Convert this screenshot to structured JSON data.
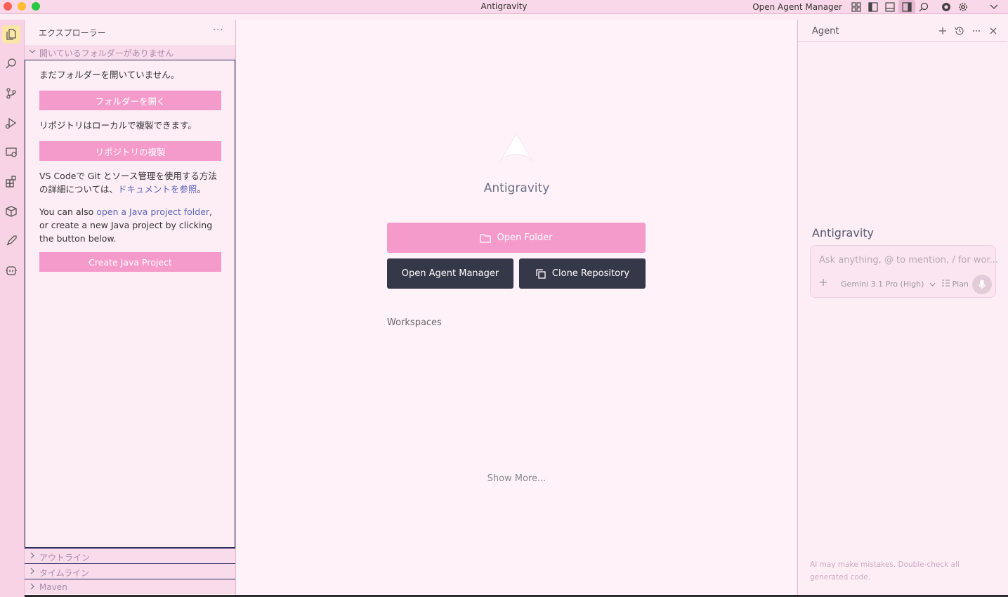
{
  "window": {
    "title": "Antigravity",
    "open_agent_manager": "Open Agent Manager"
  },
  "sidebar": {
    "header": "エクスプローラー",
    "more": "···",
    "section_title": "開いているフォルダーがありません",
    "no_folder_text": "まだフォルダーを開いていません。",
    "open_folder_button": "フォルダーを開く",
    "clone_text": "リポジトリはローカルで複製できます。",
    "clone_button": "リポジトリの複製",
    "git_text_1": "VS Codeで Git とソース管理を使用する方法",
    "git_text_2": "の詳細については、",
    "git_link": "ドキュメントを参照",
    "git_text_3": "。",
    "java_text_1": "You can also ",
    "java_link": "open a Java project folder",
    "java_text_2": ", or create a new Java project by clicking the button below.",
    "create_java_button": "Create Java Project",
    "footer_sections": [
      "アウトライン",
      "タイムライン",
      "Maven"
    ]
  },
  "main": {
    "brand": "Antigravity",
    "open_folder": "Open Folder",
    "open_agent_manager": "Open Agent Manager",
    "clone_repository": "Clone Repository",
    "workspaces": "Workspaces",
    "show_more": "Show More..."
  },
  "agent": {
    "title": "Agent",
    "brand": "Antigravity",
    "placeholder": "Ask anything, @ to mention, / for wor...",
    "model": "Gemini 3.1 Pro (High)",
    "mode": "Plan",
    "disclaimer": "AI may make mistakes. Double-check all generated code."
  },
  "colors": {
    "accent_pink": "#f59bcb",
    "dark_button": "#353848",
    "link": "#5a67b5"
  }
}
